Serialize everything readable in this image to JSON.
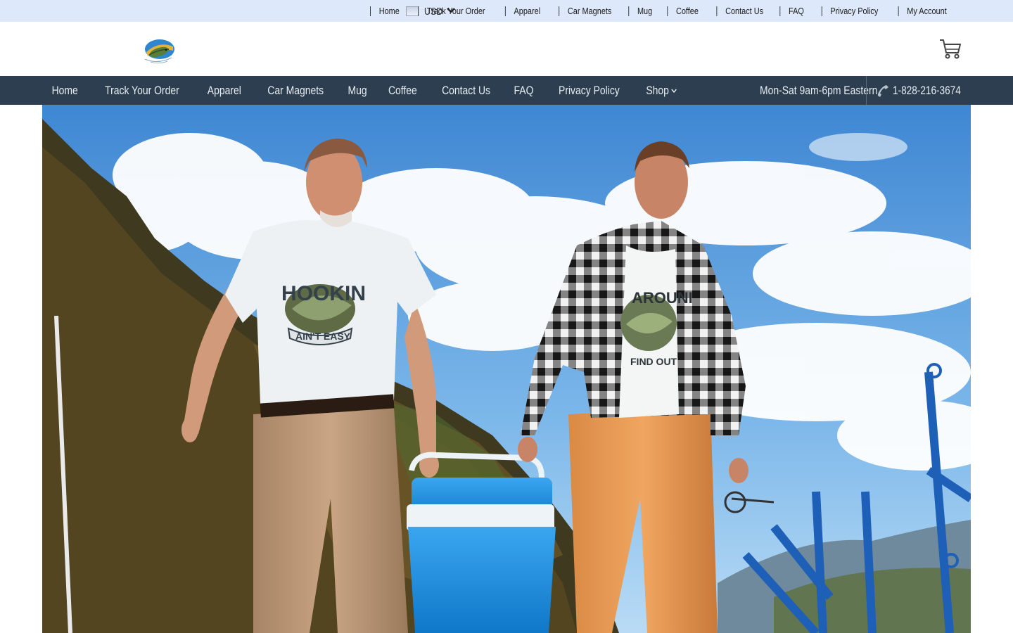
{
  "currency": {
    "selected": "USD",
    "flag_icon": "flag-icon"
  },
  "top_links": [
    "Home",
    "Track Your Order",
    "Apparel",
    "Car Magnets",
    "Mug",
    "Coffee",
    "Contact Us",
    "FAQ",
    "Privacy Policy",
    "My Account"
  ],
  "main_nav": {
    "items": [
      "Home",
      "Track Your Order",
      "Apparel",
      "Car Magnets",
      "Mug",
      "Coffee",
      "Contact Us",
      "FAQ",
      "Privacy Policy",
      "Shop"
    ],
    "hours": "Mon-Sat 9am-6pm Eastern",
    "phone": "1-828-216-3674"
  },
  "hero": {
    "shirt_left_text": [
      "HOOKIN",
      "AIN'T EASY"
    ],
    "shirt_right_text": [
      "AROUNI",
      "FIND OUT"
    ]
  },
  "colors": {
    "topbar_bg": "#dde8fb",
    "nav_bg": "#2d3e50",
    "nav_text": "#e8edf2",
    "sky": "#4f96d8",
    "cooler": "#1f8fe0"
  }
}
